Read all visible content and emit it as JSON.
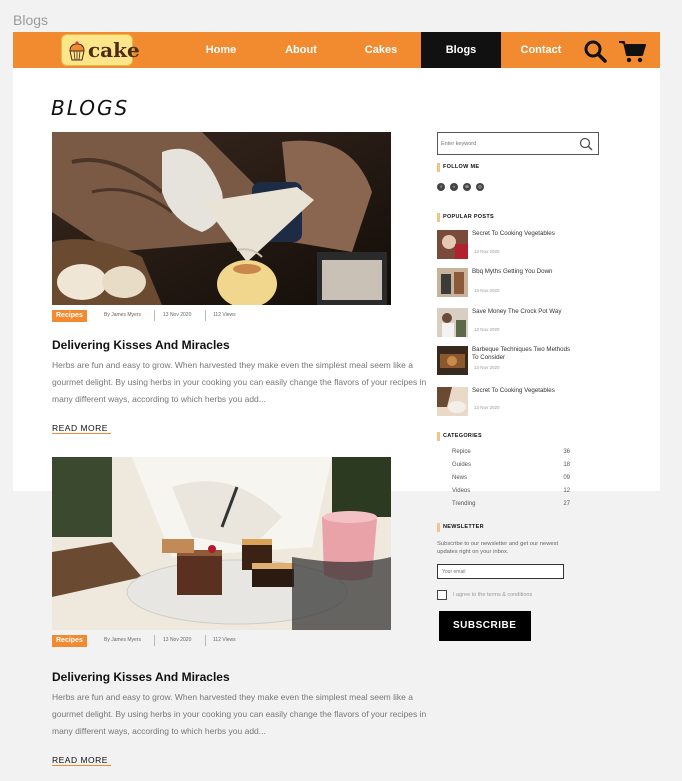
{
  "frame_title": "Blogs",
  "brand": {
    "logo_text": "cake"
  },
  "nav": {
    "items": [
      {
        "label": "Home"
      },
      {
        "label": "About"
      },
      {
        "label": "Cakes"
      },
      {
        "label": "Blogs",
        "active": true
      },
      {
        "label": "Contact"
      }
    ],
    "search_icon": "search-icon",
    "cart_icon": "cart-icon"
  },
  "page": {
    "heading": "BLOGS"
  },
  "posts": [
    {
      "category": "Recipes",
      "author": "By James Myers",
      "date": "13 Nov 2020",
      "views": "112 Views",
      "title": "Delivering Kisses And Miracles",
      "excerpt": "Herbs are fun and easy to grow. When harvested they make even the simplest meal seem like a gourmet delight. By using herbs in your cooking you can easily change the flavors of your recipes in many different ways, according to which herbs you add...",
      "read_more": "READ MORE"
    },
    {
      "category": "Recipes",
      "author": "By James Myers",
      "date": "13 Nov 2020",
      "views": "112 Views",
      "title": "Delivering Kisses And Miracles",
      "excerpt": "Herbs are fun and easy to grow. When harvested they make even the simplest meal seem like a gourmet delight. By using herbs in your cooking you can easily change the flavors of your recipes in many different ways, according to which herbs you add...",
      "read_more": "READ MORE"
    }
  ],
  "sidebar": {
    "search_placeholder": "Enter keyword",
    "follow_heading": "FOLLOW ME",
    "social_icons": [
      "facebook-icon",
      "twitter-icon",
      "email-icon",
      "instagram-icon"
    ],
    "popular_heading": "POPULAR POSTS",
    "popular_posts": [
      {
        "title": "Secret To Cooking Vegetables",
        "date": "13 Nov 2020"
      },
      {
        "title": "Bbq Myths Getting You Down",
        "date": "13 Nov 2020"
      },
      {
        "title": "Save Money The Crock Pot Way",
        "date": "13 Nov 2020"
      },
      {
        "title": "Barbeque Techniques Two Methods To Consider",
        "date": "13 Nov 2020"
      },
      {
        "title": "Secret To Cooking Vegetables",
        "date": "13 Nov 2020"
      }
    ],
    "categories_heading": "CATEGORIES",
    "categories": [
      {
        "name": "Repice",
        "count": "36"
      },
      {
        "name": "Guides",
        "count": "18"
      },
      {
        "name": "News",
        "count": "09"
      },
      {
        "name": "Videos",
        "count": "12"
      },
      {
        "name": "Trending",
        "count": "27"
      }
    ],
    "newsletter_heading": "NEWSLETTER",
    "newsletter_text": "Subscribe to our newsletter and get our newest updates right on your inbox.",
    "email_placeholder": "Your email",
    "agree_text": "I agree to the terms & conditions",
    "subscribe_label": "SUBSCRIBE"
  },
  "colors": {
    "accent": "#f28b30",
    "dark": "#111111",
    "logo_bg": "#fde68a"
  }
}
